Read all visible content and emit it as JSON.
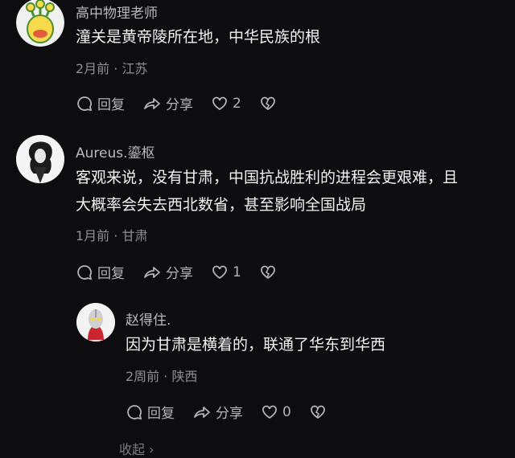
{
  "comments": [
    {
      "username": "高中物理老师",
      "lines": [
        "潼关是黄帝陵所在地，中华民族的根"
      ],
      "time": "2月前",
      "location": "江苏",
      "reply_label": "回复",
      "share_label": "分享",
      "likes": "2",
      "avatar_icon": "green-monster-avatar"
    },
    {
      "username": "Aureus.鎏枢",
      "lines": [
        "客观来说，没有甘肃，中国抗战胜利的进程会更艰难，且",
        "大概率会失去西北数省，甚至影响全国战局"
      ],
      "time": "1月前",
      "location": "甘肃",
      "reply_label": "回复",
      "share_label": "分享",
      "likes": "1",
      "avatar_icon": "anime-character-avatar"
    },
    {
      "username": "赵得住.",
      "lines": [
        "因为甘肃是横着的，联通了华东到华西"
      ],
      "time": "2周前",
      "location": "陕西",
      "reply_label": "回复",
      "share_label": "分享",
      "likes": "0",
      "avatar_icon": "ultraman-avatar"
    }
  ],
  "collapse_label": "收起 ›"
}
